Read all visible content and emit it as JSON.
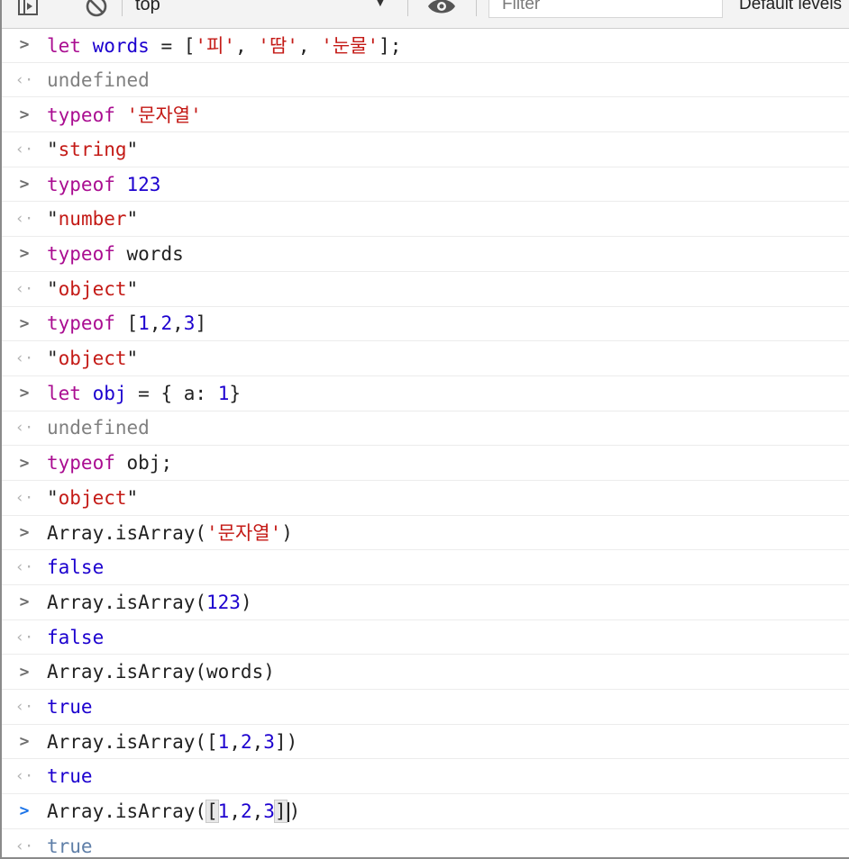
{
  "toolbar": {
    "context": "top",
    "filter_placeholder": "Filter",
    "levels_label": "Default levels"
  },
  "console": {
    "line1": {
      "kw": "let",
      "name": "words",
      "op": " = [",
      "s1": "'피'",
      "c1": ", ",
      "s2": "'땀'",
      "c2": ", ",
      "s3": "'눈물'",
      "end": "];"
    },
    "out1": "undefined",
    "line2": {
      "kw": "typeof",
      "str": "'문자열'"
    },
    "out2": {
      "q1": "\"",
      "val": "string",
      "q2": "\""
    },
    "line3": {
      "kw": "typeof",
      "num": "123"
    },
    "out3": {
      "q1": "\"",
      "val": "number",
      "q2": "\""
    },
    "line4": {
      "kw": "typeof",
      "name": "words"
    },
    "out4": {
      "q1": "\"",
      "val": "object",
      "q2": "\""
    },
    "line5": {
      "kw": "typeof",
      "open": "[",
      "n1": "1",
      "c1": ",",
      "n2": "2",
      "c2": ",",
      "n3": "3",
      "close": "]"
    },
    "out5": {
      "q1": "\"",
      "val": "object",
      "q2": "\""
    },
    "line6": {
      "kw": "let",
      "name": "obj",
      "op": " = { a: ",
      "num": "1",
      "end": "}"
    },
    "out6": "undefined",
    "line7": {
      "kw": "typeof",
      "name": "obj;"
    },
    "out7": {
      "q1": "\"",
      "val": "object",
      "q2": "\""
    },
    "line8": {
      "pre": "Array.isArray(",
      "str": "'문자열'",
      "post": ")"
    },
    "out8": "false",
    "line9": {
      "pre": "Array.isArray(",
      "num": "123",
      "post": ")"
    },
    "out9": "false",
    "line10": {
      "pre": "Array.isArray(words)"
    },
    "out10": "true",
    "line11": {
      "pre": "Array.isArray([",
      "n1": "1",
      "c1": ",",
      "n2": "2",
      "c2": ",",
      "n3": "3",
      "post": "])"
    },
    "out11": "true",
    "line12": {
      "pre": "Array.isArray(",
      "open": "[",
      "n1": "1",
      "c1": ",",
      "n2": "2",
      "c2": ",",
      "n3": "3",
      "close": "]",
      "post": ")"
    },
    "out12": "true"
  },
  "colors": {
    "keyword": "#aa0d91",
    "string": "#c41a16",
    "number": "#1c00cf",
    "undefined": "#808080",
    "prompt_active": "#1a73e8"
  }
}
